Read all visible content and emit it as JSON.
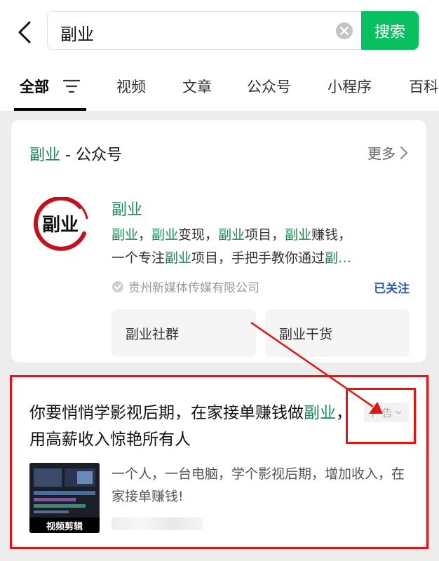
{
  "search": {
    "query": "副业",
    "button_label": "搜索"
  },
  "tabs": [
    {
      "label": "全部",
      "active": true
    },
    {
      "label": "视频"
    },
    {
      "label": "文章"
    },
    {
      "label": "公众号"
    },
    {
      "label": "小程序"
    },
    {
      "label": "百科"
    }
  ],
  "account_section": {
    "title_keyword": "副业",
    "title_rest": " - 公众号",
    "more_label": "更多",
    "account": {
      "logo_text": "副业",
      "name": "副业",
      "desc_line1": [
        "副业",
        "，",
        "副业",
        "变现，",
        "副业",
        "项目，",
        "副业",
        "赚钱，"
      ],
      "desc_line2": [
        "一个专注",
        "副业",
        "项目，手把手教你通过",
        "副…"
      ],
      "verified_org": "贵州新媒体传媒有限公司",
      "follow_status": "已关注",
      "sub_buttons": [
        "副业社群",
        "副业干货"
      ]
    }
  },
  "ad": {
    "title_part1": "你要悄悄学影视后期，在家接单赚钱做",
    "title_keyword": "副业",
    "title_part2": "，用高薪收入惊艳所有人",
    "badge_label": "广告",
    "thumb_caption": "视频剪辑",
    "description": "一个人，一台电脑，学个影视后期，增加收入，在家接单赚钱!"
  },
  "colors": {
    "accent_green": "#07c160",
    "keyword_green": "#1a8a54",
    "annotation_red": "#e21515",
    "follow_blue": "#2a5fb0"
  }
}
